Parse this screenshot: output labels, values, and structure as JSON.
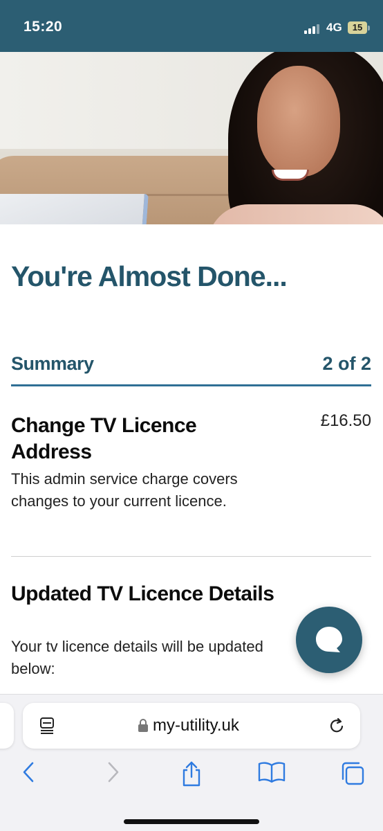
{
  "status_bar": {
    "time": "15:20",
    "network": "4G",
    "battery": "15",
    "bar_color": "#2c5e73"
  },
  "hero": {
    "icon": "person-with-laptop-photo"
  },
  "page": {
    "title": "You're Almost Done..."
  },
  "summary": {
    "label": "Summary",
    "step": "2 of 2",
    "accent_color": "#2f6f95"
  },
  "item": {
    "title": "Change TV Licence Address",
    "price": "£16.50",
    "description": "This admin service charge covers changes to your current licence."
  },
  "details": {
    "title": "Updated TV Licence Details",
    "text": "Your tv licence details will be updated below:"
  },
  "chat": {
    "icon": "chat-bubble-icon"
  },
  "browser": {
    "url": "my-utility.uk",
    "nav_icons": [
      "back-icon",
      "forward-icon",
      "share-icon",
      "bookmarks-icon",
      "tabs-icon"
    ]
  }
}
